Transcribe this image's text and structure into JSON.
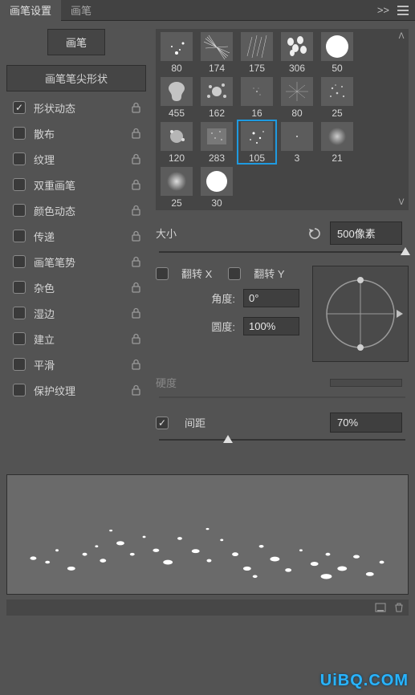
{
  "tabs": {
    "settings": "画笔设置",
    "brush": "画笔",
    "collapse": ">>"
  },
  "left": {
    "brush_btn": "画笔",
    "tip_shape": "画笔笔尖形状",
    "options": [
      {
        "label": "形状动态",
        "checked": true
      },
      {
        "label": "散布",
        "checked": false
      },
      {
        "label": "纹理",
        "checked": false
      },
      {
        "label": "双重画笔",
        "checked": false
      },
      {
        "label": "颜色动态",
        "checked": false
      },
      {
        "label": "传递",
        "checked": false
      },
      {
        "label": "画笔笔势",
        "checked": false
      },
      {
        "label": "杂色",
        "checked": false
      },
      {
        "label": "湿边",
        "checked": false
      },
      {
        "label": "建立",
        "checked": false
      },
      {
        "label": "平滑",
        "checked": false
      },
      {
        "label": "保护纹理",
        "checked": false
      }
    ]
  },
  "thumbs": [
    {
      "v": "80"
    },
    {
      "v": "174"
    },
    {
      "v": "175"
    },
    {
      "v": "306"
    },
    {
      "v": "50"
    },
    {
      "v": "455"
    },
    {
      "v": "162"
    },
    {
      "v": "16"
    },
    {
      "v": "80"
    },
    {
      "v": "25"
    },
    {
      "v": "120"
    },
    {
      "v": "283"
    },
    {
      "v": "105",
      "sel": true
    },
    {
      "v": "3"
    },
    {
      "v": "21"
    },
    {
      "v": "25"
    },
    {
      "v": "30"
    }
  ],
  "controls": {
    "size_label": "大小",
    "size_value": "500像素",
    "size_pct": 100,
    "flip_x": "翻转 X",
    "flip_y": "翻转 Y",
    "angle_label": "角度:",
    "angle_value": "0°",
    "round_label": "圆度:",
    "round_value": "100%",
    "hardness_label": "硬度",
    "hardness_value": "",
    "spacing_label": "间距",
    "spacing_value": "70%",
    "spacing_checked": true,
    "spacing_pct": 28
  },
  "watermark": "UiBQ.COM"
}
